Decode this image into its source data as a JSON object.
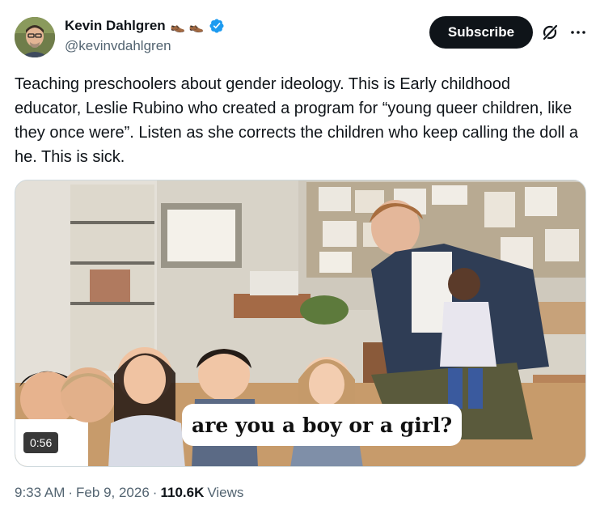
{
  "author": {
    "display_name": "Kevin Dahlgren",
    "emoji": "👞 👞",
    "handle": "@kevinvdahlgren",
    "verified": true
  },
  "actions": {
    "subscribe_label": "Subscribe"
  },
  "tweet": {
    "text": "Teaching preschoolers about gender ideology. This is Early childhood educator, Leslie Rubino who created a program for “young queer children, like they once were”. Listen as she corrects the children who keep calling the doll a he. This is sick."
  },
  "media": {
    "caption": "are you a boy or a girl?",
    "duration": "0:56"
  },
  "meta": {
    "time": "9:33 AM",
    "sep1": "·",
    "date": "Feb 9, 2026",
    "sep2": "·",
    "views_count": "110.6K",
    "views_label": "Views"
  },
  "colors": {
    "text_primary": "#0f1419",
    "text_secondary": "#536471",
    "verified_blue": "#1d9bf0",
    "button_dark": "#0f1419"
  }
}
